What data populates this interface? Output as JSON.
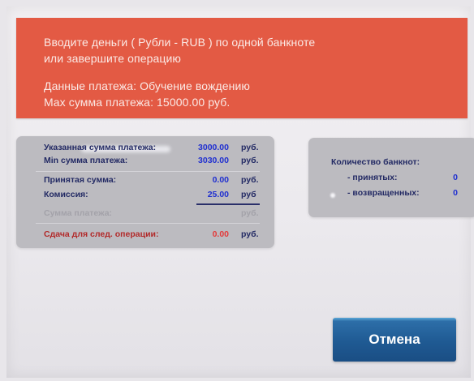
{
  "banner": {
    "line1": "Вводите деньги ( Рубли - RUB ) по одной банкноте",
    "line2": "или завершите операцию",
    "line3": "Данные платежа: Обучение вождению",
    "line4": "Max сумма платежа: 15000.00 руб."
  },
  "summary": {
    "rows": [
      {
        "label": "Указанная сумма платежа:",
        "value": "3000.00",
        "currency": "руб."
      },
      {
        "label": "Min сумма платежа:",
        "value": "3030.00",
        "currency": "руб."
      },
      {
        "label": "Принятая сумма:",
        "value": "0.00",
        "currency": "руб."
      },
      {
        "label": "Комиссия:",
        "value": "25.00",
        "currency": "руб"
      },
      {
        "label": "Сумма платежа:",
        "value": "",
        "currency": "руб."
      },
      {
        "label": "Сдача для след. операции:",
        "value": "0.00",
        "currency": "руб."
      }
    ]
  },
  "banknotes": {
    "title": "Количество банкнот:",
    "accepted_label": "- принятых:",
    "accepted_value": "0",
    "returned_label": "- возвращенных:",
    "returned_value": "0"
  },
  "actions": {
    "cancel_label": "Отмена"
  },
  "colors": {
    "banner": "#e35a44",
    "panel": "#bcbbc0",
    "value_blue": "#1f2fd0",
    "label_navy": "#232a64",
    "change_red": "#e33b3b",
    "button": "#1f5a93"
  }
}
